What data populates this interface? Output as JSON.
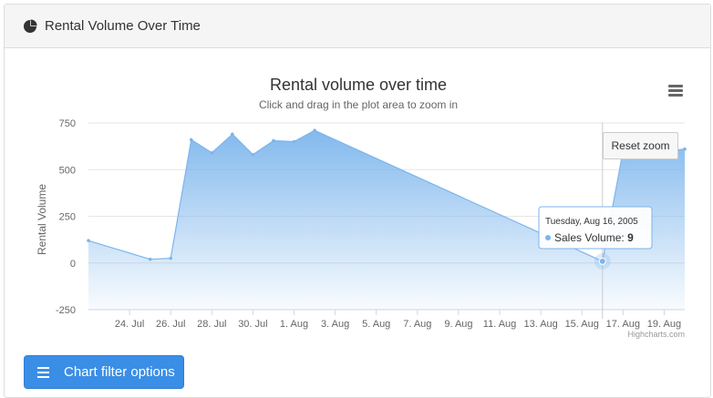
{
  "panel": {
    "title": "Rental Volume Over Time",
    "icon": "pie-chart-icon"
  },
  "chart_data": {
    "type": "area",
    "title": "Rental volume over time",
    "subtitle": "Click and drag in the plot area to zoom in",
    "ylabel": "Rental Volume",
    "ylim": [
      -250,
      750
    ],
    "yticks": [
      -250,
      0,
      250,
      500,
      750
    ],
    "xlim": [
      "2005-07-22",
      "2005-08-20"
    ],
    "xticks": [
      {
        "date": "2005-07-24",
        "label": "24. Jul"
      },
      {
        "date": "2005-07-26",
        "label": "26. Jul"
      },
      {
        "date": "2005-07-28",
        "label": "28. Jul"
      },
      {
        "date": "2005-07-30",
        "label": "30. Jul"
      },
      {
        "date": "2005-08-01",
        "label": "1. Aug"
      },
      {
        "date": "2005-08-03",
        "label": "3. Aug"
      },
      {
        "date": "2005-08-05",
        "label": "5. Aug"
      },
      {
        "date": "2005-08-07",
        "label": "7. Aug"
      },
      {
        "date": "2005-08-09",
        "label": "9. Aug"
      },
      {
        "date": "2005-08-11",
        "label": "11. Aug"
      },
      {
        "date": "2005-08-13",
        "label": "13. Aug"
      },
      {
        "date": "2005-08-15",
        "label": "15. Aug"
      },
      {
        "date": "2005-08-17",
        "label": "17. Aug"
      },
      {
        "date": "2005-08-19",
        "label": "19. Aug"
      }
    ],
    "series": [
      {
        "name": "Sales Volume",
        "points": [
          {
            "date": "2005-07-22",
            "value": 120
          },
          {
            "date": "2005-07-25",
            "value": 20
          },
          {
            "date": "2005-07-26",
            "value": 25
          },
          {
            "date": "2005-07-27",
            "value": 660
          },
          {
            "date": "2005-07-28",
            "value": 590
          },
          {
            "date": "2005-07-29",
            "value": 690
          },
          {
            "date": "2005-07-30",
            "value": 580
          },
          {
            "date": "2005-07-31",
            "value": 655
          },
          {
            "date": "2005-08-01",
            "value": 650
          },
          {
            "date": "2005-08-02",
            "value": 710
          },
          {
            "date": "2005-08-16",
            "value": 9
          },
          {
            "date": "2005-08-17",
            "value": 600
          },
          {
            "date": "2005-08-18",
            "value": 600
          },
          {
            "date": "2005-08-19",
            "value": 600
          },
          {
            "date": "2005-08-20",
            "value": 610
          }
        ]
      }
    ],
    "tooltip": {
      "date_label": "Tuesday, Aug 16, 2005",
      "series_label": "Sales Volume:",
      "value_label": "9",
      "date": "2005-08-16",
      "value": 9
    },
    "credits": "Highcharts.com",
    "grid": true,
    "colors": {
      "line": "#7cb5ec",
      "fill_top": "#7cb5ec",
      "fill_bottom": "#ffffff"
    }
  },
  "toolbar": {
    "reset_zoom_label": "Reset zoom",
    "menu_icon": "hamburger-menu-icon"
  },
  "filter": {
    "label": "Chart filter options",
    "icon": "bars-icon"
  }
}
